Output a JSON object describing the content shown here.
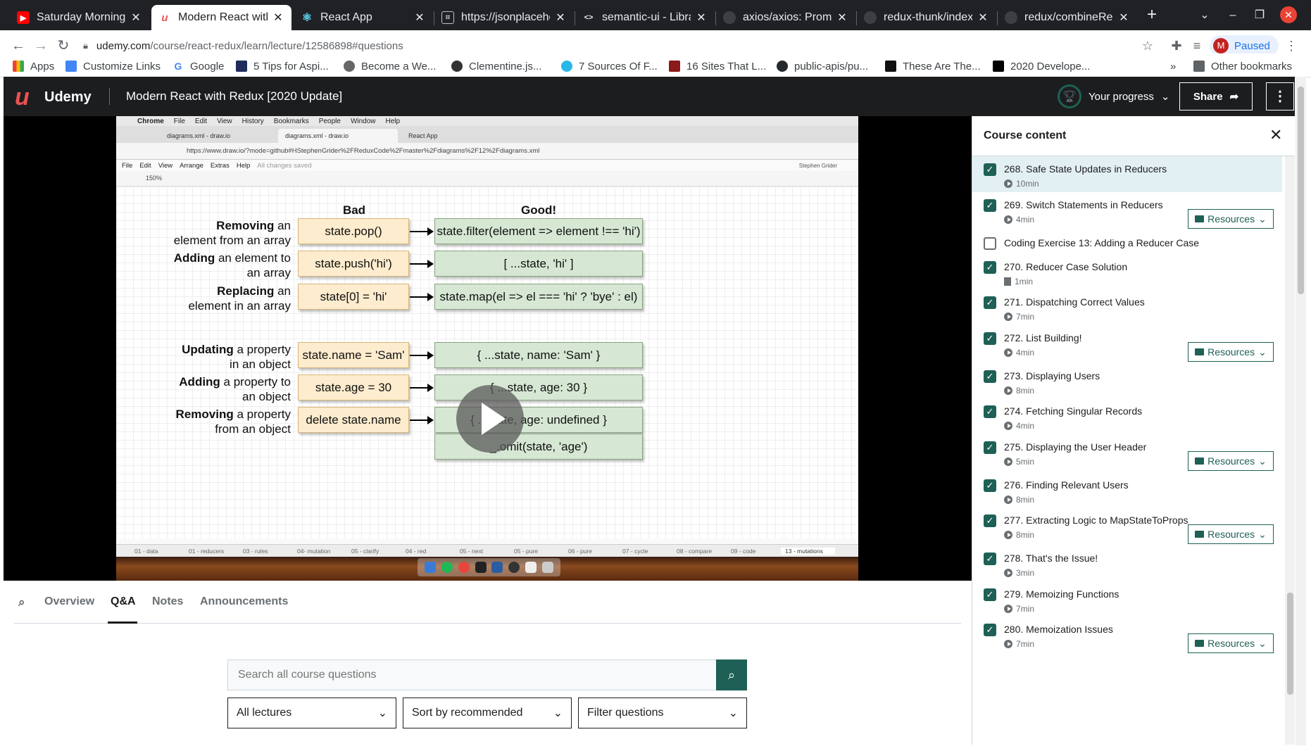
{
  "browser": {
    "tabs": [
      {
        "title": "Saturday Morning J",
        "icon": "youtube-icon"
      },
      {
        "title": "Modern React with",
        "icon": "udemy-icon"
      },
      {
        "title": "React App",
        "icon": "react-icon"
      },
      {
        "title": "https://jsonplacehol",
        "icon": "page-icon"
      },
      {
        "title": "semantic-ui - Librari",
        "icon": "code-icon"
      },
      {
        "title": "axios/axios: Promis",
        "icon": "github-icon"
      },
      {
        "title": "redux-thunk/index.",
        "icon": "github-icon"
      },
      {
        "title": "redux/combineRed",
        "icon": "github-icon"
      }
    ],
    "url_host": "udemy.com",
    "url_path": "/course/react-redux/learn/lecture/12586898#questions",
    "profile_initial": "M",
    "profile_status": "Paused",
    "bookmarks": [
      "Apps",
      "Customize Links",
      "Google",
      "5 Tips for Aspi...",
      "Become a We...",
      "Clementine.js...",
      "7 Sources Of F...",
      "16 Sites That L...",
      "public-apis/pu...",
      "These Are The...",
      "2020 Develope..."
    ],
    "other_bookmarks": "Other bookmarks"
  },
  "header": {
    "logo_text": "Udemy",
    "course_title": "Modern React with Redux [2020 Update]",
    "progress_label": "Your progress",
    "share_label": "Share"
  },
  "video": {
    "mac_menu": [
      "Chrome",
      "File",
      "Edit",
      "View",
      "History",
      "Bookmarks",
      "People",
      "Window",
      "Help"
    ],
    "inner_tabs": [
      "diagrams.xml - draw.io",
      "diagrams.xml - draw.io",
      "React App"
    ],
    "inner_url": "https://www.draw.io/?mode=github#HStephenGrider%2FReduxCode%2Fmaster%2Fdiagrams%2F12%2Fdiagrams.xml",
    "drawio_menu": [
      "File",
      "Edit",
      "View",
      "Arrange",
      "Extras",
      "Help"
    ],
    "drawio_saved": "All changes saved",
    "drawio_user": "Stephen Grider",
    "zoom": "150%",
    "diagram": {
      "bad_heading": "Bad",
      "good_heading": "Good!",
      "rows": [
        {
          "label_bold": "Removing",
          "label_rest": " an",
          "label_line2": "element from an array",
          "bad": "state.pop()",
          "good": "state.filter(element => element !== 'hi')"
        },
        {
          "label_bold": "Adding",
          "label_rest": " an element to",
          "label_line2": "an array",
          "bad": "state.push('hi')",
          "good": "[ ...state, 'hi' ]"
        },
        {
          "label_bold": "Replacing",
          "label_rest": " an",
          "label_line2": "element in an array",
          "bad": "state[0] = 'hi'",
          "good": "state.map(el => el === 'hi' ? 'bye' : el)"
        },
        {
          "label_bold": "Updating",
          "label_rest": " a property",
          "label_line2": "in an object",
          "bad": "state.name = 'Sam'",
          "good": "{ ...state, name: 'Sam' }"
        },
        {
          "label_bold": "Adding",
          "label_rest": " a property to",
          "label_line2": "an object",
          "bad": "state.age = 30",
          "good": "{ ...state, age: 30 }"
        },
        {
          "label_bold": "Removing",
          "label_rest": " a property",
          "label_line2": "from an object",
          "bad": "delete state.name",
          "good": "{ ...state, age: undefined }"
        }
      ],
      "extra_good": "_.omit(state, 'age')"
    },
    "pages": [
      "01 - data",
      "01 - reducers",
      "03 - rules",
      "04- mutation",
      "05 - clarify",
      "04 - red",
      "05 - next",
      "05 - pure",
      "06 - pure",
      "07 - cycle",
      "08 - compare",
      "09 - code",
      "13 - mutations"
    ]
  },
  "lower": {
    "tabs": [
      "Overview",
      "Q&A",
      "Notes",
      "Announcements"
    ],
    "active_tab": "Q&A",
    "search_placeholder": "Search all course questions",
    "filter_lectures": "All lectures",
    "filter_sort": "Sort by recommended",
    "filter_questions": "Filter questions"
  },
  "sidebar": {
    "title": "Course content",
    "resources_label": "Resources",
    "items": [
      {
        "title": "268. Safe State Updates in Reducers",
        "meta": "10min",
        "type": "video",
        "done": true,
        "resources": false
      },
      {
        "title": "269. Switch Statements in Reducers",
        "meta": "4min",
        "type": "video",
        "done": true,
        "resources": true
      },
      {
        "title": "Coding Exercise 13: Adding a Reducer Case",
        "meta": "",
        "type": "exercise",
        "done": false,
        "resources": false
      },
      {
        "title": "270. Reducer Case Solution",
        "meta": "1min",
        "type": "file",
        "done": true,
        "resources": false
      },
      {
        "title": "271. Dispatching Correct Values",
        "meta": "7min",
        "type": "video",
        "done": true,
        "resources": false
      },
      {
        "title": "272. List Building!",
        "meta": "4min",
        "type": "video",
        "done": true,
        "resources": true
      },
      {
        "title": "273. Displaying Users",
        "meta": "8min",
        "type": "video",
        "done": true,
        "resources": false
      },
      {
        "title": "274. Fetching Singular Records",
        "meta": "4min",
        "type": "video",
        "done": true,
        "resources": false
      },
      {
        "title": "275. Displaying the User Header",
        "meta": "5min",
        "type": "video",
        "done": true,
        "resources": true
      },
      {
        "title": "276. Finding Relevant Users",
        "meta": "8min",
        "type": "video",
        "done": true,
        "resources": false
      },
      {
        "title": "277. Extracting Logic to MapStateToProps",
        "meta": "8min",
        "type": "video",
        "done": true,
        "resources": true
      },
      {
        "title": "278. That's the Issue!",
        "meta": "3min",
        "type": "video",
        "done": true,
        "resources": false
      },
      {
        "title": "279. Memoizing Functions",
        "meta": "7min",
        "type": "video",
        "done": true,
        "resources": false
      },
      {
        "title": "280. Memoization Issues",
        "meta": "7min",
        "type": "video",
        "done": true,
        "resources": true
      }
    ]
  },
  "colors": {
    "udemy_red": "#ec5252",
    "teal": "#1e6055",
    "header_bg": "#1c1d1f"
  }
}
